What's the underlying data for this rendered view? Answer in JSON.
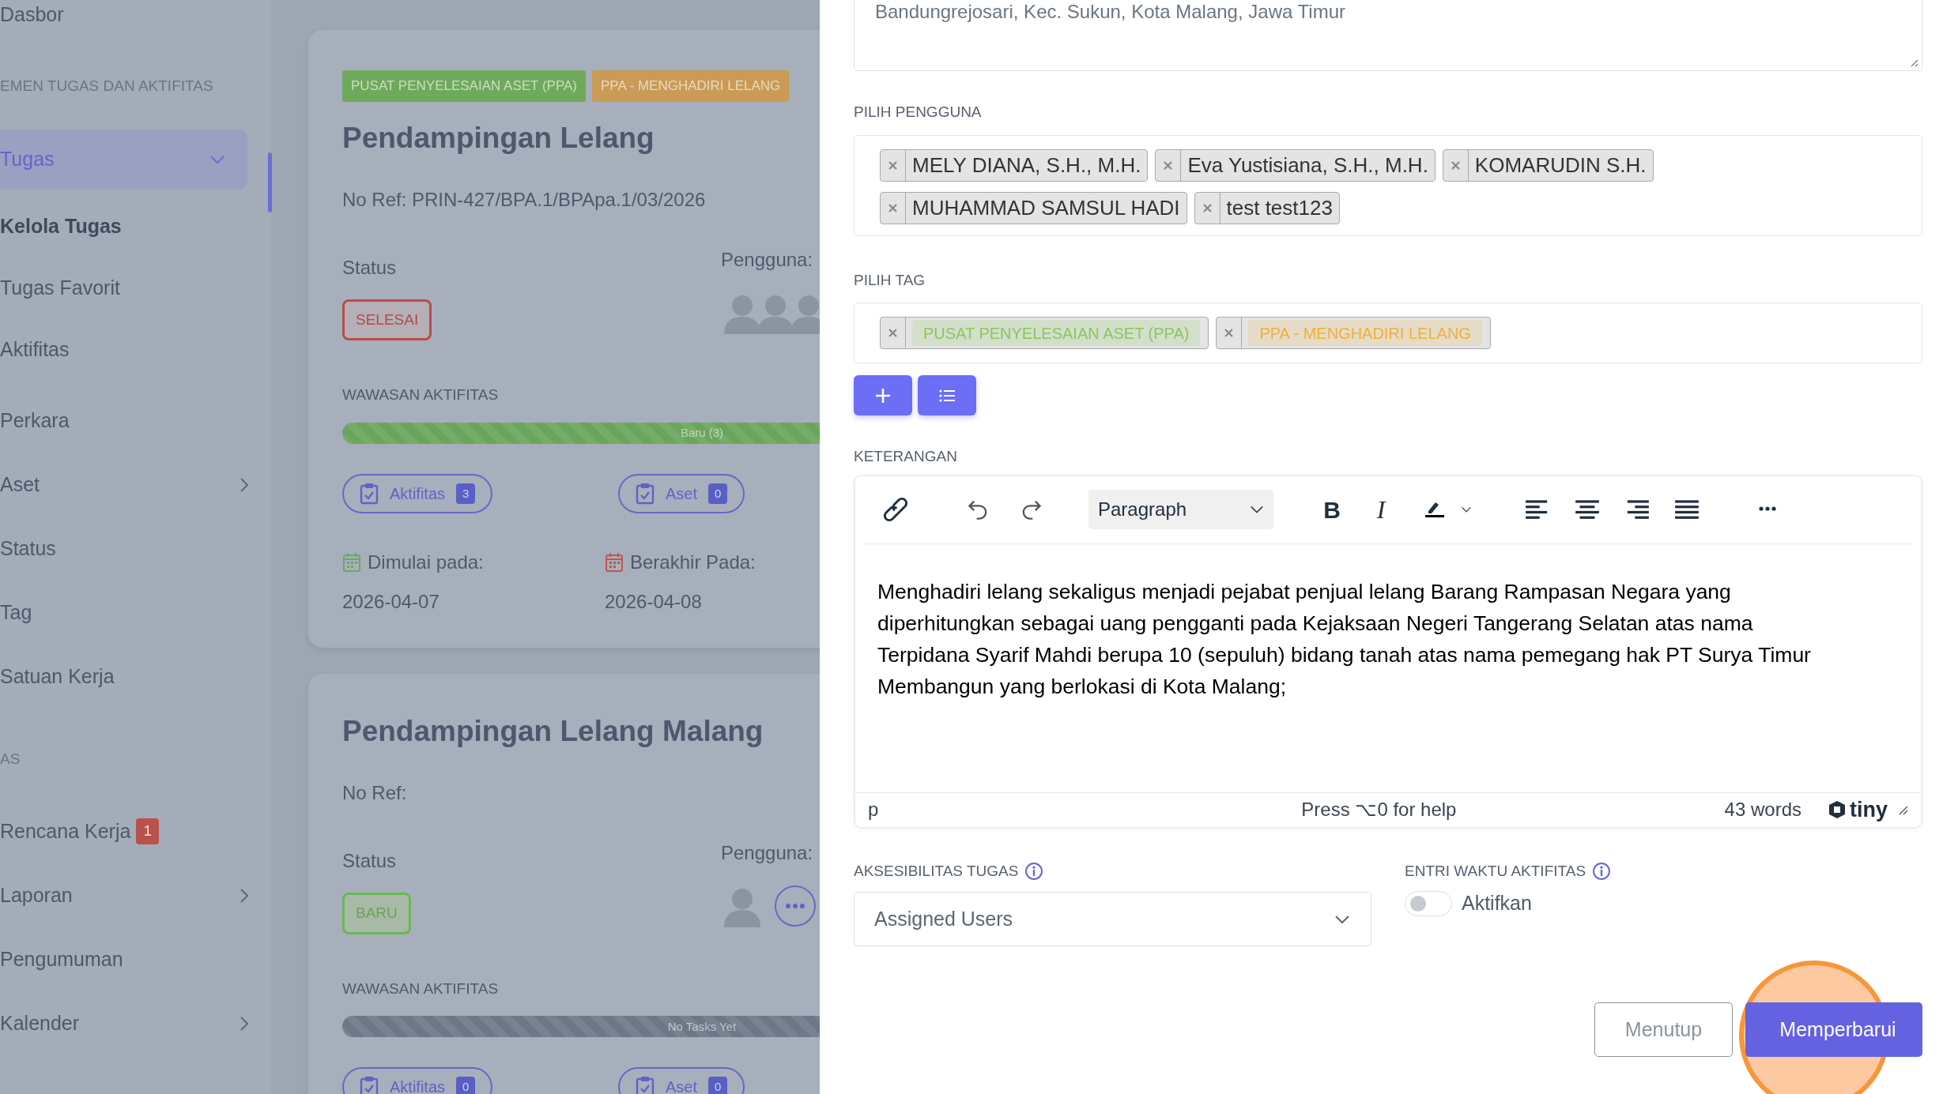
{
  "sidebar": {
    "items": [
      {
        "kind": "link",
        "label": "Dasbor",
        "selected": false
      },
      {
        "kind": "section",
        "label": "EMEN TUGAS DAN AKTIFITAS"
      },
      {
        "kind": "link",
        "label": "Tugas",
        "selected": true,
        "expanded": true
      },
      {
        "kind": "sublink",
        "label": "Kelola Tugas",
        "selected": true
      },
      {
        "kind": "sublink",
        "label": "Tugas Favorit",
        "selected": false
      },
      {
        "kind": "sublink",
        "label": "Aktifitas",
        "selected": false
      },
      {
        "kind": "link",
        "label": "Perkara",
        "selected": false
      },
      {
        "kind": "link",
        "label": "Aset",
        "selected": false,
        "expanded": false
      },
      {
        "kind": "link",
        "label": "Status",
        "selected": false
      },
      {
        "kind": "link",
        "label": "Tag",
        "selected": false
      },
      {
        "kind": "link",
        "label": "Satuan Kerja",
        "selected": false
      },
      {
        "kind": "section",
        "label": "AS"
      },
      {
        "kind": "link",
        "label": "Rencana Kerja",
        "selected": false,
        "badge": "1"
      },
      {
        "kind": "link",
        "label": "Laporan",
        "selected": false,
        "expanded": false
      },
      {
        "kind": "link",
        "label": "Pengumuman",
        "selected": false
      },
      {
        "kind": "link",
        "label": "Kalender",
        "selected": false,
        "expanded": false
      }
    ]
  },
  "task_cards": [
    {
      "tags": [
        {
          "label": "PUSAT PENYELESAIAN ASET (PPA)",
          "color": "#6fa95c"
        },
        {
          "label": "PPA - MENGHADIRI LELANG",
          "color": "#c99b57"
        }
      ],
      "title": "Pendampingan Lelang",
      "ref": "No Ref: PRIN-427/BPA.1/BPApa.1/03/2026",
      "status_label": "Status",
      "users_label": "Pengguna:",
      "status": {
        "label": "SELESAI",
        "kind": "done"
      },
      "avatars": [
        {
          "kind": "person"
        },
        {
          "kind": "person"
        },
        {
          "kind": "person"
        }
      ],
      "insight_label": "WAWASAN AKTIFITAS",
      "progress": {
        "kind": "new",
        "level": 1,
        "label": "Baru (3)"
      },
      "buttons": [
        {
          "label": "Aktifitas",
          "count": "3"
        },
        {
          "label": "Aset",
          "count": "0"
        }
      ],
      "dates": [
        {
          "kind": "start",
          "label": "Dimulai pada:",
          "value": "2026-04-07"
        },
        {
          "kind": "end",
          "label": "Berakhir Pada:",
          "value": "2026-04-08"
        }
      ]
    },
    {
      "title": "Pendampingan Lelang Malang",
      "ref": "No Ref:",
      "status_label": "Status",
      "users_label": "Pengguna:",
      "status": {
        "label": "BARU",
        "kind": "new"
      },
      "avatars": [
        {
          "kind": "person"
        },
        {
          "kind": "more"
        }
      ],
      "insight_label": "WAWASAN AKTIFITAS",
      "progress": {
        "kind": "empty",
        "level": 1,
        "label": "No Tasks Yet"
      },
      "buttons": [
        {
          "label": "Aktifitas",
          "count": "0"
        },
        {
          "label": "Aset",
          "count": "0"
        }
      ]
    }
  ],
  "form": {
    "address": {
      "value": "Bandungrejosari, Kec. Sukun, Kota Malang, Jawa Timur"
    },
    "users": {
      "label": "PILIH PENGGUNA",
      "chips": [
        "MELY DIANA, S.H., M.H.",
        "Eva Yustisiana, S.H., M.H.",
        "KOMARUDIN S.H.",
        "MUHAMMAD SAMSUL HADI",
        "test test123"
      ]
    },
    "tags": {
      "label": "PILIH TAG",
      "chips": [
        {
          "label": "PUSAT PENYELESAIAN ASET (PPA)",
          "color": "#86c95a"
        },
        {
          "label": "PPA - MENGHADIRI LELANG",
          "color": "#efb03c"
        }
      ]
    },
    "tag_buttons": [
      {
        "kind": "add"
      },
      {
        "kind": "list"
      }
    ],
    "description": {
      "label": "KETERANGAN",
      "block_format": "Paragraph",
      "format_buttons": [
        {
          "kind": "bold",
          "glyph": "B"
        },
        {
          "kind": "italic",
          "glyph": "I"
        }
      ],
      "text": "Menghadiri lelang sekaligus menjadi pejabat penjual lelang Barang Rampasan Negara yang diperhitungkan sebagai uang pengganti pada Kejaksaan Negeri Tangerang Selatan atas nama Terpidana Syarif Mahdi berupa 10 (sepuluh) bidang tanah atas nama pemegang hak PT Surya Timur Membangun yang berlokasi di Kota Malang;",
      "path": "p",
      "help": "Press ⌥0 for help",
      "word_count": "43 words",
      "brand": "tiny"
    },
    "access": {
      "label": "AKSESIBILITAS TUGAS",
      "value": "Assigned Users"
    },
    "time_entry": {
      "label": "ENTRI WAKTU AKTIFITAS",
      "toggle_label": "Aktifkan",
      "on": false
    },
    "buttons": [
      {
        "kind": "secondary",
        "label": "Menutup"
      },
      {
        "kind": "primary",
        "label": "Memperbarui"
      }
    ],
    "click_marker": {
      "visible": true
    }
  }
}
